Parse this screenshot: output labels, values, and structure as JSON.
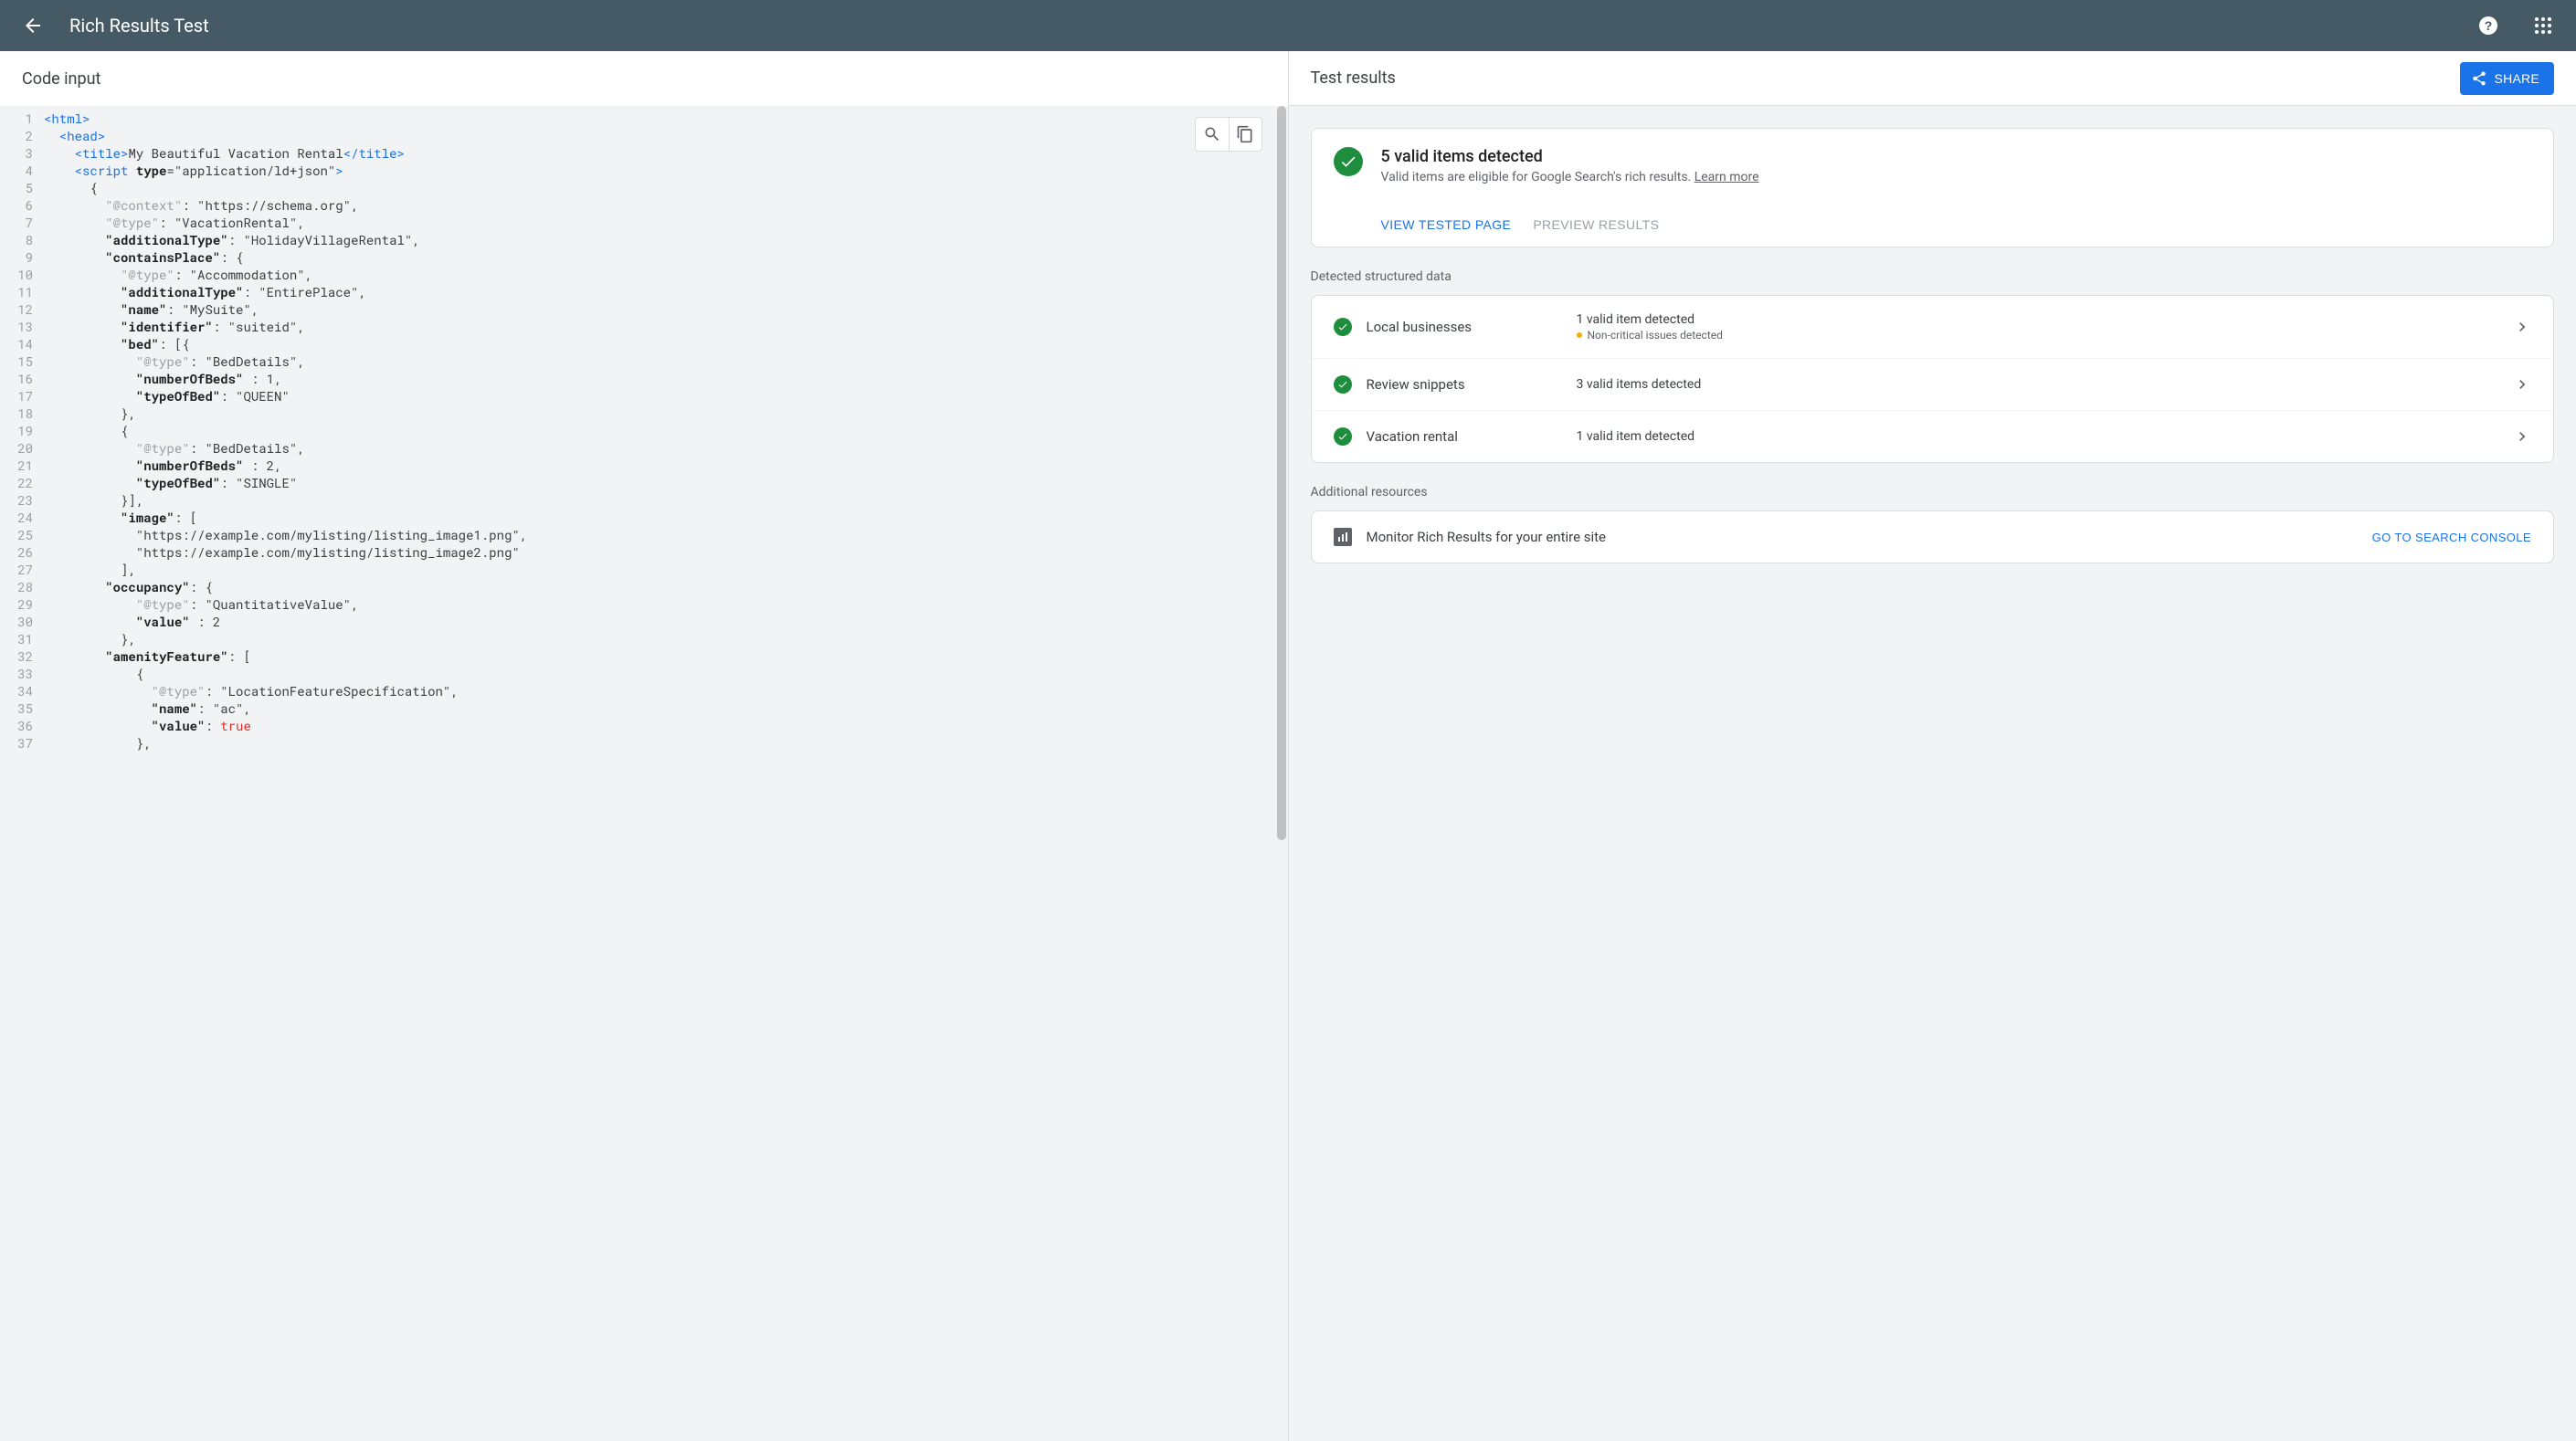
{
  "header": {
    "title": "Rich Results Test"
  },
  "left": {
    "title": "Code input",
    "codeLines": [
      "<html>",
      "  <head>",
      "    <title>My Beautiful Vacation Rental</title>",
      "    <script type=\"application/ld+json\">",
      "      {",
      "        \"@context\": \"https://schema.org\",",
      "        \"@type\": \"VacationRental\",",
      "        \"additionalType\": \"HolidayVillageRental\",",
      "        \"containsPlace\": {",
      "          \"@type\": \"Accommodation\",",
      "          \"additionalType\": \"EntirePlace\",",
      "          \"name\": \"MySuite\",",
      "          \"identifier\": \"suiteid\",",
      "          \"bed\": [{",
      "            \"@type\": \"BedDetails\",",
      "            \"numberOfBeds\" : 1,",
      "            \"typeOfBed\": \"QUEEN\"",
      "          },",
      "          {",
      "            \"@type\": \"BedDetails\",",
      "            \"numberOfBeds\" : 2,",
      "            \"typeOfBed\": \"SINGLE\"",
      "          }],",
      "          \"image\": [",
      "            \"https://example.com/mylisting/listing_image1.png\",",
      "            \"https://example.com/mylisting/listing_image2.png\"",
      "          ],",
      "        \"occupancy\": {",
      "            \"@type\": \"QuantitativeValue\",",
      "            \"value\" : 2",
      "          },",
      "        \"amenityFeature\": [",
      "            {",
      "              \"@type\": \"LocationFeatureSpecification\",",
      "              \"name\": \"ac\",",
      "              \"value\": true",
      "            },"
    ]
  },
  "right": {
    "title": "Test results",
    "share": "SHARE",
    "status": {
      "title": "5 valid items detected",
      "subtitle_prefix": "Valid items are eligible for Google Search's rich results. ",
      "learn_more": "Learn more"
    },
    "actions": {
      "view": "VIEW TESTED PAGE",
      "preview": "PREVIEW RESULTS"
    },
    "section_data": "Detected structured data",
    "items": [
      {
        "label": "Local businesses",
        "status": "1 valid item detected",
        "sub": "Non-critical issues detected",
        "warn": true
      },
      {
        "label": "Review snippets",
        "status": "3 valid items detected",
        "sub": "",
        "warn": false
      },
      {
        "label": "Vacation rental",
        "status": "1 valid item detected",
        "sub": "",
        "warn": false
      }
    ],
    "section_res": "Additional resources",
    "resource": {
      "label": "Monitor Rich Results for your entire site",
      "action": "GO TO SEARCH CONSOLE"
    }
  }
}
